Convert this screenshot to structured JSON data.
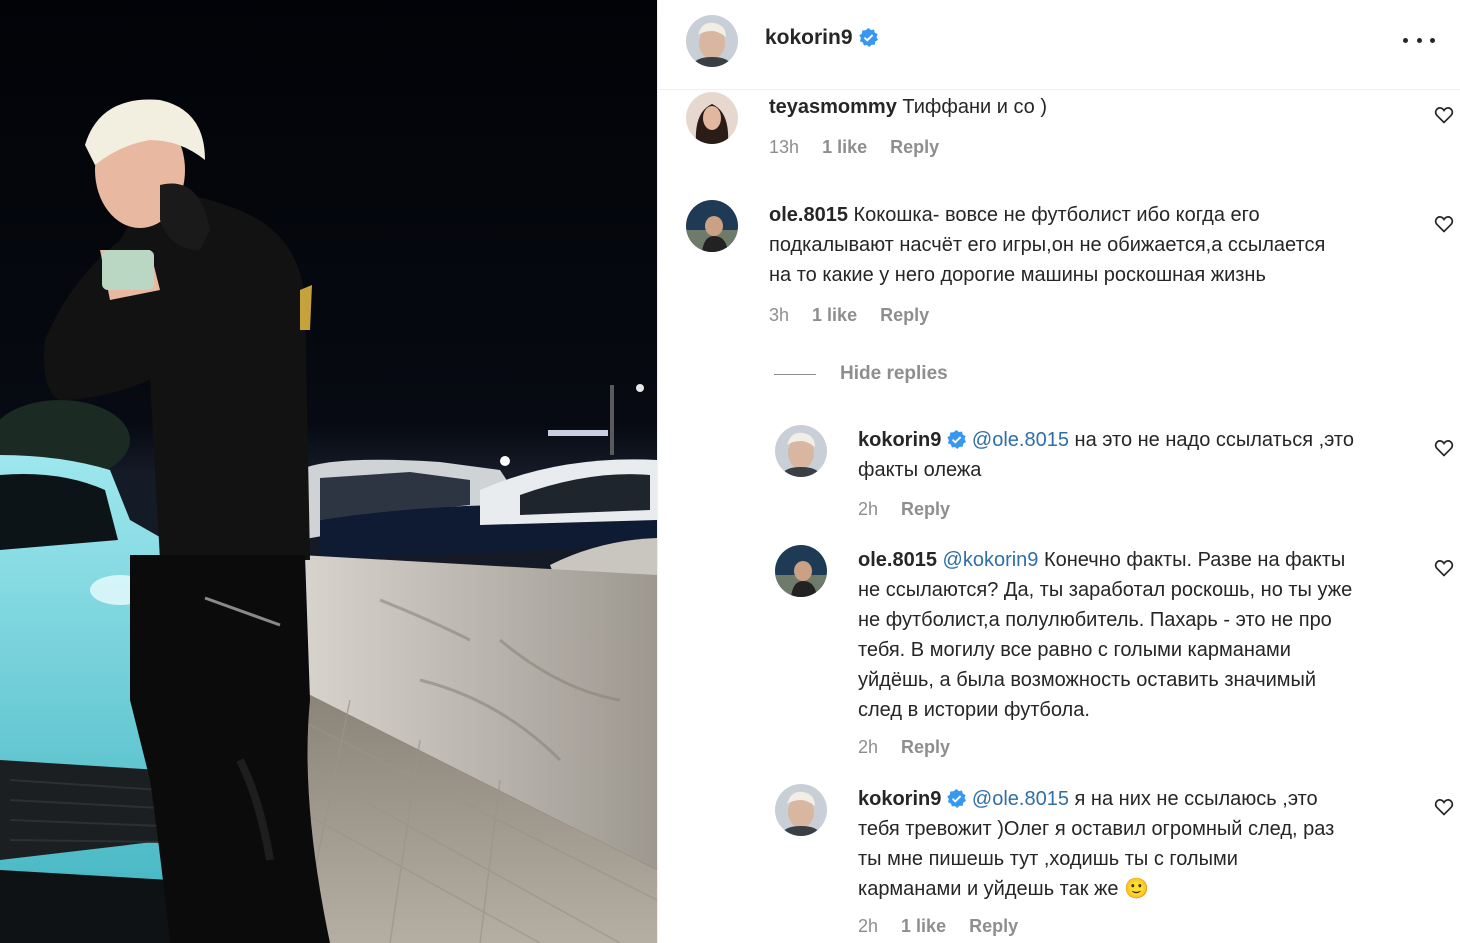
{
  "post": {
    "author": "kokorin9",
    "more_icon": "more-horizontal-icon"
  },
  "comments": [
    {
      "user": "teyasmommy",
      "text": "Тиффани и со )",
      "time": "13h",
      "likes": "1 like",
      "reply": "Reply"
    },
    {
      "user": "ole.8015",
      "text_lines": [
        "Кокошка- вовсе не футболист ибо когда его",
        "подкалывают насчёт его игры,он не обижается,а ссылается",
        "на то какие у него дорогие машины роскошная жизнь"
      ],
      "time": "3h",
      "likes": "1 like",
      "reply": "Reply"
    }
  ],
  "hide_replies": "Hide replies",
  "replies": [
    {
      "user": "kokorin9",
      "mention": "@ole.8015",
      "text_lines": [
        "на это не надо ссылаться ,это",
        "факты олежа"
      ],
      "time": "2h",
      "reply": "Reply"
    },
    {
      "user": "ole.8015",
      "mention": "@kokorin9",
      "text_lines": [
        "Конечно факты. Разве на факты",
        "не ссылаются? Да, ты заработал роскошь, но ты уже",
        "не футболист,а полулюбитель. Пахарь - это не про",
        "тебя. В могилу все равно с голыми карманами",
        "уйдёшь, а была возможность оставить значимый",
        "след в истории футбола."
      ],
      "time": "2h",
      "reply": "Reply"
    },
    {
      "user": "kokorin9",
      "mention": "@ole.8015",
      "text_lines": [
        "я на них не ссылаюсь ,это",
        "тебя тревожит )Олег я оставил огромный след, раз",
        "ты мне пишешь тут ,ходишь ты с голыми",
        "карманами и уйдешь так же 🙂"
      ],
      "time": "2h",
      "likes": "1 like",
      "reply": "Reply"
    }
  ],
  "colors": {
    "mention": "#2f6ea8",
    "verified": "#3897f0",
    "meta": "#8e8e8e"
  }
}
